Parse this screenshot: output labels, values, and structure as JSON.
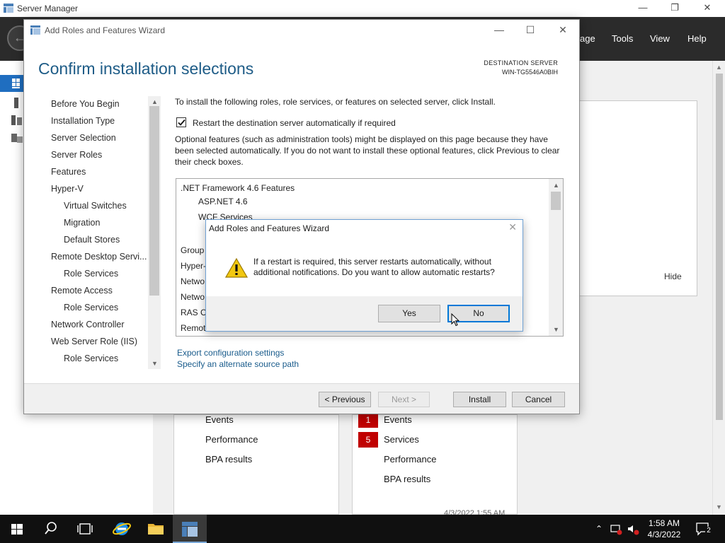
{
  "server_manager": {
    "title": "Server Manager",
    "window_controls": {
      "minimize": "—",
      "maximize": "❐",
      "close": "✕"
    },
    "menu": [
      "age",
      "Tools",
      "View",
      "Help"
    ],
    "welcome_hide": "Hide",
    "tiles": {
      "left": [
        "Events",
        "Performance",
        "BPA results"
      ],
      "right": [
        {
          "badge": "1",
          "label": "Events"
        },
        {
          "badge": "5",
          "label": "Services"
        },
        {
          "badge": "",
          "label": "Performance"
        },
        {
          "badge": "",
          "label": "BPA results"
        }
      ],
      "timestamp": "4/3/2022 1:55 AM"
    }
  },
  "wizard": {
    "title": "Add Roles and Features Wizard",
    "heading": "Confirm installation selections",
    "destination_label": "DESTINATION SERVER",
    "destination_server": "WIN-TG5546A0BIH",
    "nav": [
      {
        "label": "Before You Begin",
        "indent": 0
      },
      {
        "label": "Installation Type",
        "indent": 0
      },
      {
        "label": "Server Selection",
        "indent": 0
      },
      {
        "label": "Server Roles",
        "indent": 0
      },
      {
        "label": "Features",
        "indent": 0
      },
      {
        "label": "Hyper-V",
        "indent": 0
      },
      {
        "label": "Virtual Switches",
        "indent": 1
      },
      {
        "label": "Migration",
        "indent": 1
      },
      {
        "label": "Default Stores",
        "indent": 1
      },
      {
        "label": "Remote Desktop Servi...",
        "indent": 0
      },
      {
        "label": "Role Services",
        "indent": 1
      },
      {
        "label": "Remote Access",
        "indent": 0
      },
      {
        "label": "Role Services",
        "indent": 1
      },
      {
        "label": "Network Controller",
        "indent": 0
      },
      {
        "label": "Web Server Role (IIS)",
        "indent": 0
      },
      {
        "label": "Role Services",
        "indent": 1
      }
    ],
    "instruction": "To install the following roles, role services, or features on selected server, click Install.",
    "restart_checkbox_label": "Restart the destination server automatically if required",
    "restart_checked": true,
    "optional_text": "Optional features (such as administration tools) might be displayed on this page because they have been selected automatically. If you do not want to install these optional features, click Previous to clear their check boxes.",
    "features": [
      {
        "label": ".NET Framework 4.6 Features",
        "indent": 0
      },
      {
        "label": "ASP.NET 4.6",
        "indent": 1
      },
      {
        "label": "WCF Services",
        "indent": 1
      },
      {
        "label": "Group",
        "indent": 0
      },
      {
        "label": "Hyper-",
        "indent": 0
      },
      {
        "label": "Netwo",
        "indent": 0
      },
      {
        "label": "Netwo",
        "indent": 0
      },
      {
        "label": "RAS Co",
        "indent": 0
      },
      {
        "label": "Remote",
        "indent": 0
      }
    ],
    "links": {
      "export": "Export configuration settings",
      "alternate_source": "Specify an alternate source path"
    },
    "buttons": {
      "previous": "< Previous",
      "next": "Next >",
      "install": "Install",
      "cancel": "Cancel"
    }
  },
  "dialog": {
    "title": "Add Roles and Features Wizard",
    "message": "If a restart is required, this server restarts automatically, without additional notifications. Do you want to allow automatic restarts?",
    "yes": "Yes",
    "no": "No"
  },
  "taskbar": {
    "time": "1:58 AM",
    "date": "4/3/2022",
    "notification_count": "2"
  }
}
